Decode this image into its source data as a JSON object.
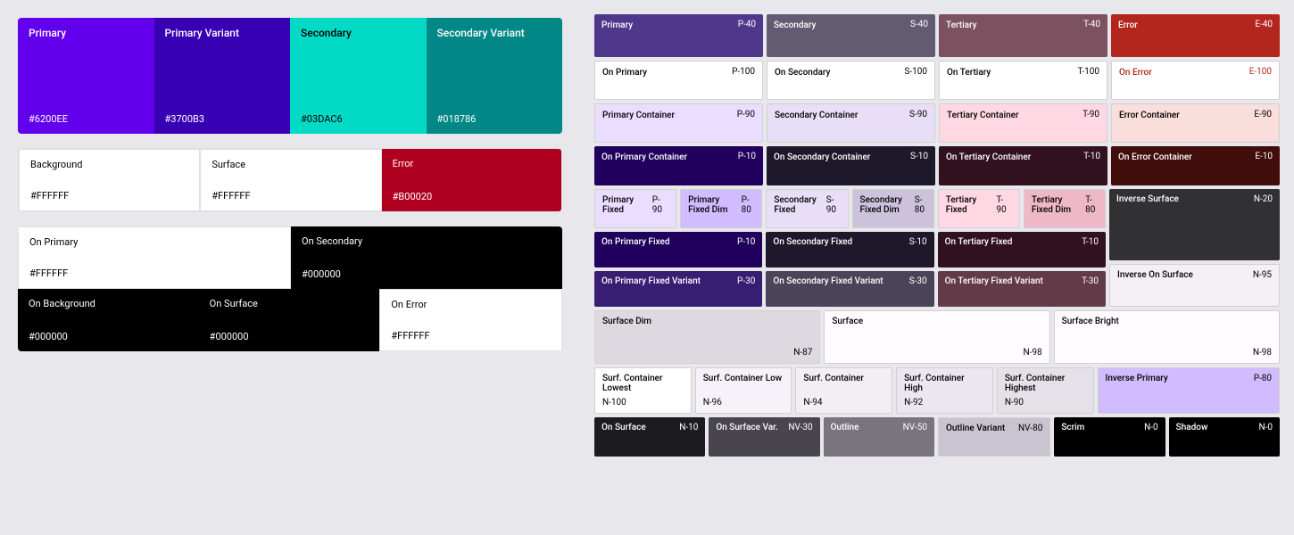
{
  "left": {
    "swatchRow": [
      {
        "label": "Primary",
        "hex": "#6200EE",
        "bg": "#6200EE",
        "fg": "#ffffff"
      },
      {
        "label": "Primary Variant",
        "hex": "#3700B3",
        "bg": "#3700B3",
        "fg": "#ffffff"
      },
      {
        "label": "Secondary",
        "hex": "#03DAC6",
        "bg": "#03DAC6",
        "fg": "#000000"
      },
      {
        "label": "Secondary Variant",
        "hex": "#018786",
        "bg": "#018786",
        "fg": "#ffffff"
      }
    ],
    "neutralRow1": [
      {
        "label": "Background",
        "hex": "#FFFFFF",
        "bg": "#ffffff",
        "fg": "#000000",
        "border": true
      },
      {
        "label": "Surface",
        "hex": "#FFFFFF",
        "bg": "#ffffff",
        "fg": "#000000",
        "border": true
      },
      {
        "label": "Error",
        "hex": "#B00020",
        "bg": "#B00020",
        "fg": "#ffffff",
        "border": false
      }
    ],
    "neutralRow2": [
      {
        "label": "On Primary",
        "hex": "#FFFFFF",
        "bg": "#ffffff",
        "fg": "#000000",
        "border": true
      },
      {
        "label": "On Secondary",
        "hex": "#000000",
        "bg": "#000000",
        "fg": "#ffffff",
        "border": false
      }
    ],
    "neutralRow3": [
      {
        "label": "On Background",
        "hex": "#000000",
        "bg": "#000000",
        "fg": "#ffffff",
        "border": false
      },
      {
        "label": "On Surface",
        "hex": "#000000",
        "bg": "#000000",
        "fg": "#ffffff",
        "border": false
      },
      {
        "label": "On Error",
        "hex": "#FFFFFF",
        "bg": "#ffffff",
        "fg": "#000000",
        "border": true
      }
    ]
  },
  "right": {
    "row1": [
      {
        "label": "Primary",
        "code": "P-40",
        "bg": "#4f378b",
        "fg": "#ffffff"
      },
      {
        "label": "Secondary",
        "code": "S-40",
        "bg": "#625b71",
        "fg": "#ffffff"
      },
      {
        "label": "Tertiary",
        "code": "T-40",
        "bg": "#7d5260",
        "fg": "#ffffff"
      },
      {
        "label": "Error",
        "code": "E-40",
        "bg": "#b3261e",
        "fg": "#ffffff"
      }
    ],
    "row2": [
      {
        "label": "On Primary",
        "code": "P-100",
        "bg": "#ffffff",
        "fg": "#000000",
        "border": true
      },
      {
        "label": "On Secondary",
        "code": "S-100",
        "bg": "#ffffff",
        "fg": "#000000",
        "border": true
      },
      {
        "label": "On Tertiary",
        "code": "T-100",
        "bg": "#ffffff",
        "fg": "#000000",
        "border": true
      },
      {
        "label": "On Error",
        "code": "E-100",
        "bg": "#ffffff",
        "fg": "#b3261e",
        "labelColor": "#b3261e",
        "border": true
      }
    ],
    "row3": [
      {
        "label": "Primary Container",
        "code": "P-90",
        "bg": "#eaddff",
        "fg": "#000000",
        "border": true
      },
      {
        "label": "Secondary Container",
        "code": "S-90",
        "bg": "#e8def8",
        "fg": "#000000",
        "border": true
      },
      {
        "label": "Tertiary Container",
        "code": "T-90",
        "bg": "#ffd8e4",
        "fg": "#000000",
        "border": true
      },
      {
        "label": "Error Container",
        "code": "E-90",
        "bg": "#f9dedc",
        "fg": "#000000",
        "border": true
      }
    ],
    "row4": [
      {
        "label": "On Primary Container",
        "code": "P-10",
        "bg": "#21005d",
        "fg": "#ffffff"
      },
      {
        "label": "On Secondary Container",
        "code": "S-10",
        "bg": "#1d192b",
        "fg": "#ffffff"
      },
      {
        "label": "On Tertiary Container",
        "code": "T-10",
        "bg": "#31111d",
        "fg": "#ffffff"
      },
      {
        "label": "On Error Container",
        "code": "E-10",
        "bg": "#410e0b",
        "fg": "#ffffff"
      }
    ],
    "row5": [
      {
        "label": "Primary Fixed",
        "code": "P-90",
        "bg": "#eaddff",
        "fg": "#000000",
        "border": true
      },
      {
        "label": "Primary Fixed Dim",
        "code": "P-80",
        "bg": "#d0bcff",
        "fg": "#000000",
        "border": true
      },
      {
        "label": "Secondary Fixed",
        "code": "S-90",
        "bg": "#e8def8",
        "fg": "#000000",
        "border": true
      },
      {
        "label": "Secondary Fixed Dim",
        "code": "S-80",
        "bg": "#ccc2dc",
        "fg": "#000000",
        "border": true
      },
      {
        "label": "Tertiary Fixed",
        "code": "T-90",
        "bg": "#ffd8e4",
        "fg": "#000000",
        "border": true
      },
      {
        "label": "Tertiary Fixed Dim",
        "code": "T-80",
        "bg": "#efb8c8",
        "fg": "#000000",
        "border": true
      }
    ],
    "row6": [
      {
        "label": "On Primary Fixed",
        "code": "P-10",
        "bg": "#21005d",
        "fg": "#ffffff"
      },
      {
        "label": "On Secondary Fixed",
        "code": "S-10",
        "bg": "#1d192b",
        "fg": "#ffffff"
      },
      {
        "label": "On Tertiary Fixed",
        "code": "T-10",
        "bg": "#31111d",
        "fg": "#ffffff"
      }
    ],
    "row7": [
      {
        "label": "On Primary Fixed Variant",
        "code": "P-30",
        "bg": "#381e72",
        "fg": "#ffffff"
      },
      {
        "label": "On Secondary Fixed Variant",
        "code": "S-30",
        "bg": "#4a4458",
        "fg": "#ffffff"
      },
      {
        "label": "On Tertiary Fixed Variant",
        "code": "T-30",
        "bg": "#633b48",
        "fg": "#ffffff"
      }
    ],
    "row8": [
      {
        "label": "Surface Dim",
        "code": "N-87",
        "bg": "#ded8e1",
        "fg": "#000000",
        "border": true
      },
      {
        "label": "Surface",
        "code": "N-98",
        "bg": "#fffbfe",
        "fg": "#000000",
        "border": true
      },
      {
        "label": "Surface Bright",
        "code": "N-98",
        "bg": "#fffbfe",
        "fg": "#000000",
        "border": true
      },
      {
        "label": "Inverse Surface",
        "code": "N-20",
        "bg": "#313033",
        "fg": "#ffffff"
      }
    ],
    "row9": [
      {
        "label": "",
        "code": "",
        "bg": "transparent",
        "fg": "#000000",
        "invisible": true
      },
      {
        "label": "",
        "code": "",
        "bg": "transparent",
        "fg": "#000000",
        "invisible": true
      },
      {
        "label": "",
        "code": "",
        "bg": "transparent",
        "fg": "#000000",
        "invisible": true
      },
      {
        "label": "Inverse On Surface",
        "code": "N-95",
        "bg": "#f4eff4",
        "fg": "#000000",
        "border": true
      }
    ],
    "surfContRow": [
      {
        "label": "Surf. Container Lowest",
        "code": "N-100",
        "bg": "#ffffff",
        "fg": "#000000",
        "border": true
      },
      {
        "label": "Surf. Container Low",
        "code": "N-96",
        "bg": "#f7f2fa",
        "fg": "#000000",
        "border": true
      },
      {
        "label": "Surf. Container",
        "code": "N-94",
        "bg": "#f3eef3",
        "fg": "#000000",
        "border": true
      },
      {
        "label": "Surf. Container High",
        "code": "N-92",
        "bg": "#ece6f0",
        "fg": "#000000",
        "border": true
      },
      {
        "label": "Surf. Container Highest",
        "code": "N-90",
        "bg": "#e6e0e9",
        "fg": "#000000",
        "border": true
      },
      {
        "label": "Inverse Primary",
        "code": "P-80",
        "bg": "#d0bcff",
        "fg": "#000000",
        "border": true
      }
    ],
    "bottomRow": [
      {
        "label": "On Surface",
        "code": "N-10",
        "bg": "#1c1b1f",
        "fg": "#ffffff"
      },
      {
        "label": "On Surface Var.",
        "code": "NV-30",
        "bg": "#49454f",
        "fg": "#ffffff"
      },
      {
        "label": "Outline",
        "code": "NV-50",
        "bg": "#79747e",
        "fg": "#ffffff"
      },
      {
        "label": "Outline Variant",
        "code": "NV-80",
        "bg": "#cac4d0",
        "fg": "#000000",
        "border": true
      },
      {
        "label": "Scrim",
        "code": "N-0",
        "bg": "#000000",
        "fg": "#ffffff"
      },
      {
        "label": "Shadow",
        "code": "N-0",
        "bg": "#000000",
        "fg": "#ffffff"
      }
    ]
  }
}
